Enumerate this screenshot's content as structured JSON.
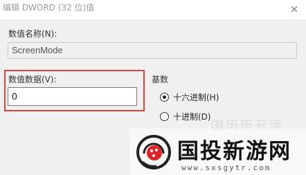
{
  "window": {
    "title": "编辑 DWORD (32 位)值",
    "close_glyph": "×"
  },
  "value_name": {
    "label": "数值名称(N):",
    "value": "ScreenMode"
  },
  "value_data": {
    "label": "数值数据(V):",
    "value": "0",
    "highlight_color": "#d9443a"
  },
  "base": {
    "label": "基数",
    "options": [
      {
        "label": "十六进制(H)",
        "selected": true
      },
      {
        "label": "十进制(D)",
        "selected": false
      }
    ]
  },
  "watermark": {
    "faint_text": "国历历元活",
    "site_name": "国投新游网",
    "url": "www.sxsgytr.com",
    "logo_color": "#e0232b"
  }
}
